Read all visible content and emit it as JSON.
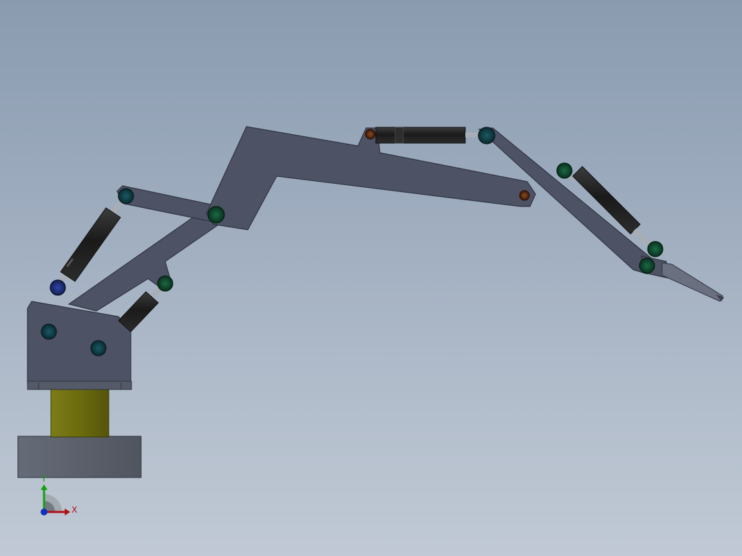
{
  "viewport": {
    "background_top": "#8a9bb0",
    "background_bottom": "#c0c9d5"
  },
  "colors": {
    "link_fill": "#4d5364",
    "link_edge": "#2f3340",
    "base_plate": "#5a5f6d",
    "column": "#707010",
    "cylinder_dark": "#1c1c1c",
    "cylinder_mid": "#383838",
    "rod": "#a9adb5",
    "pin_green": "#0f4a2f",
    "pin_teal": "#103f46",
    "pin_blue": "#1c2e73",
    "pin_brown": "#5a2d12",
    "axis_x": "#b01010",
    "axis_y": "#10a010",
    "axis_z": "#1030c0"
  },
  "triad": {
    "x_label": "X",
    "y_label": "Y"
  }
}
